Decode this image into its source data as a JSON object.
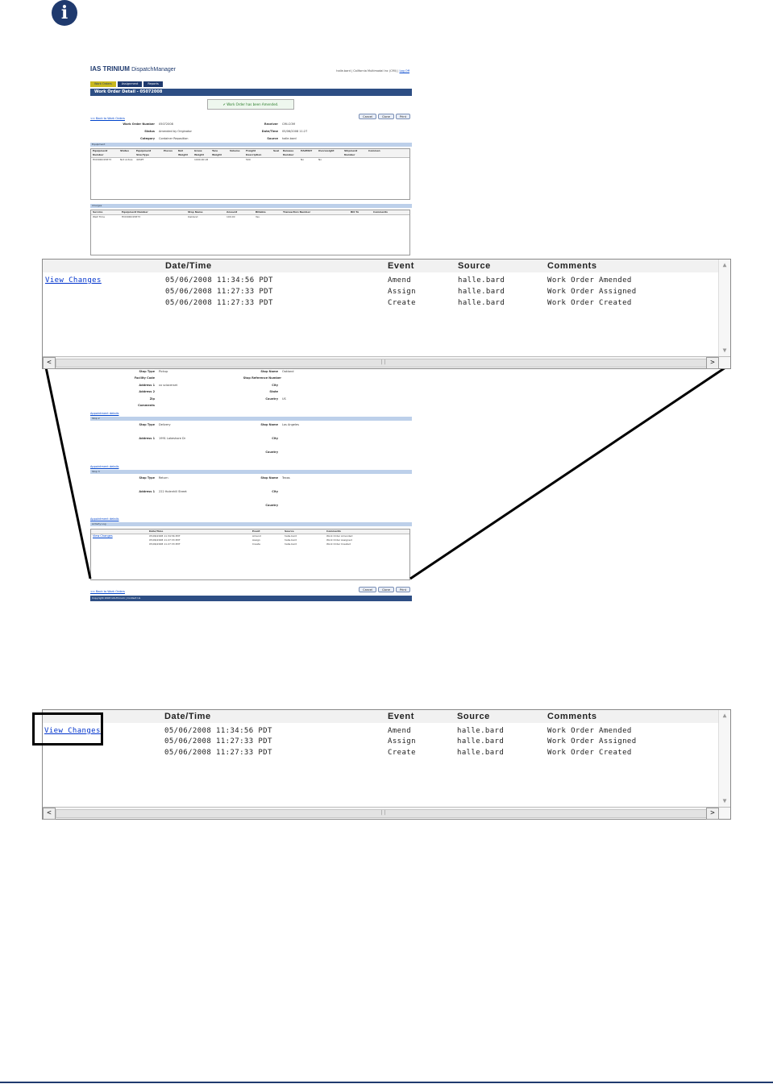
{
  "info_glyph": "i",
  "app": {
    "logo": "IAS TRINIUM",
    "product": "DispatchManager",
    "user": "halle.bard | California Multimodal Inc (CMI) |",
    "logout": "Log Off",
    "tabs": [
      "Work Orders",
      "Assignment",
      "Reports"
    ],
    "title": "Work Order Detail - 05072008",
    "success": "Work Order has been Amended.",
    "back_link": "<< Back to Work Orders",
    "buttons": [
      "Cancel",
      "Clone",
      "Print"
    ],
    "fields_left": [
      {
        "label": "Work Order Number",
        "value": "05072008"
      },
      {
        "label": "Status",
        "value": "Amended by Originator"
      },
      {
        "label": "Category",
        "value": "Container Reposition"
      }
    ],
    "fields_right": [
      {
        "label": "Receiver",
        "value": "CMI-COM"
      },
      {
        "label": "Date/Time",
        "value": "05/06/2008 11:27"
      },
      {
        "label": "Source",
        "value": "halle.bard"
      }
    ],
    "equipment_section": "Equipment",
    "equipment_headers": [
      "Equipment Number",
      "Status",
      "Equipment Size/Type",
      "Pieces",
      "Net Weight",
      "Gross Weight",
      "Tare Weight",
      "Volume",
      "Freight Description",
      "Seal",
      "Release Number",
      "HAZMAT",
      "Overweight",
      "Shipment Number",
      "Commen"
    ],
    "equipment_row": [
      "HCDORO15873",
      "Not Active",
      "40SPT",
      "",
      "",
      "1000.00 LB",
      "",
      "",
      "500",
      "",
      "",
      "No",
      "No",
      "",
      ""
    ],
    "charges_section": "Charges",
    "charges_headers": [
      "Service",
      "Equipment Number",
      "Stop Name",
      "Amount",
      "Billable",
      "Transaction Number",
      "Bill To",
      "Comments"
    ],
    "charges_row": [
      "Wait Time",
      "HCDORO15873",
      "Oakland",
      "100.00",
      "Yes",
      "",
      "",
      ""
    ],
    "stops": [
      {
        "section": "",
        "stop_type": "Pickup",
        "stop_name": "Oakland",
        "address1": "xx sciacerset",
        "country": "US"
      },
      {
        "section": "Stop 2",
        "stop_type": "Delivery",
        "stop_name": "Los Angeles",
        "address1": "1991 Lakeshore Dr",
        "country": ""
      },
      {
        "section": "Stop 3",
        "stop_type": "Return",
        "stop_name": "Texas",
        "address1": "222 Holenhill Street",
        "country": ""
      }
    ],
    "stop_labels": {
      "stop_type": "Stop Type",
      "facility": "Facility Code",
      "address1": "Address 1",
      "address2": "Address 2",
      "zip": "Zip",
      "comments": "Comments",
      "stop_name": "Stop Name",
      "stop_ref": "Stop Reference Number",
      "city": "City",
      "state": "State",
      "country": "Country"
    },
    "appointment_link": "Appointment details",
    "activity_section": "Activity Log",
    "footer": "Copyright 2008 IAS-Trinium | Contact Us"
  },
  "activity_log": {
    "headers": {
      "datetime": "Date/Time",
      "event": "Event",
      "source": "Source",
      "comments": "Comments"
    },
    "view_changes": "View Changes",
    "rows": [
      {
        "datetime": "05/06/2008 11:34:56 PDT",
        "event": "Amend",
        "source": "halle.bard",
        "comments": "Work Order Amended"
      },
      {
        "datetime": "05/06/2008 11:27:33 PDT",
        "event": "Assign",
        "source": "halle.bard",
        "comments": "Work Order Assigned"
      },
      {
        "datetime": "05/06/2008 11:27:33 PDT",
        "event": "Create",
        "source": "halle.bard",
        "comments": "Work Order Created"
      }
    ],
    "scroll_left": "<",
    "scroll_right": ">",
    "scroll_thumb": "||"
  }
}
